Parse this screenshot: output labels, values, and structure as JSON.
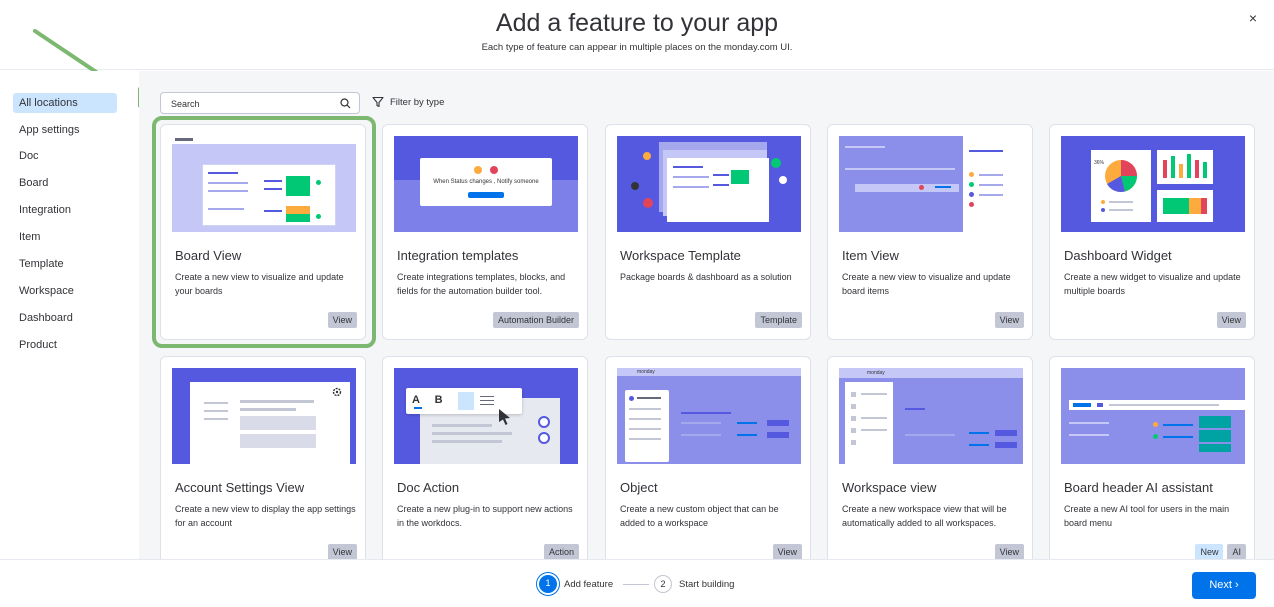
{
  "header": {
    "title": "Add a feature to your app",
    "subtitle": "Each type of feature can appear in multiple places on the monday.com UI.",
    "close": "×"
  },
  "sidebar": {
    "items": [
      {
        "label": "All locations",
        "active": true
      },
      {
        "label": "App settings"
      },
      {
        "label": "Doc"
      },
      {
        "label": "Board"
      },
      {
        "label": "Integration"
      },
      {
        "label": "Item"
      },
      {
        "label": "Template"
      },
      {
        "label": "Workspace"
      },
      {
        "label": "Dashboard"
      },
      {
        "label": "Product"
      }
    ]
  },
  "search": {
    "placeholder": "Search"
  },
  "filter": {
    "label": "Filter by type"
  },
  "cards": [
    {
      "title": "Board View",
      "desc": "Create a new view to visualize and update your boards",
      "tags": [
        "View"
      ]
    },
    {
      "title": "Integration templates",
      "desc": "Create integrations templates, blocks, and fields for the automation builder tool.",
      "tags": [
        "Automation Builder"
      ],
      "image_text": "When Status changes , Notify someone"
    },
    {
      "title": "Workspace Template",
      "desc": "Package boards & dashboard as a solution",
      "tags": [
        "Template"
      ]
    },
    {
      "title": "Item View",
      "desc": "Create a new view to visualize and update board items",
      "tags": [
        "View"
      ]
    },
    {
      "title": "Dashboard Widget",
      "desc": "Create a new widget to visualize and update multiple boards",
      "tags": [
        "View"
      ],
      "image_text": "36%"
    },
    {
      "title": "Account Settings View",
      "desc": "Create a new view to display the app settings for an account",
      "tags": [
        "View"
      ]
    },
    {
      "title": "Doc Action",
      "desc": "Create a new plug-in to support new actions in the workdocs.",
      "tags": [
        "Action"
      ],
      "image_text": "A B I"
    },
    {
      "title": "Object",
      "desc": "Create a new custom object that can be added to a workspace",
      "tags": [
        "View"
      ],
      "image_text": "monday"
    },
    {
      "title": "Workspace view",
      "desc": "Create a new workspace view that will be automatically added to all workspaces.",
      "tags": [
        "View"
      ],
      "image_text": "monday"
    },
    {
      "title": "Board header AI assistant",
      "desc": "Create a new AI tool for users in the main board menu",
      "tags": [
        "New",
        "AI"
      ]
    }
  ],
  "footer": {
    "steps": [
      {
        "num": "1",
        "label": "Add feature",
        "active": true
      },
      {
        "num": "2",
        "label": "Start building"
      }
    ],
    "next": "Next ›"
  },
  "colors": {
    "accent": "#0073ea",
    "illustration": "#5559df",
    "highlight": "#7db870",
    "arrow": "#7db870"
  }
}
